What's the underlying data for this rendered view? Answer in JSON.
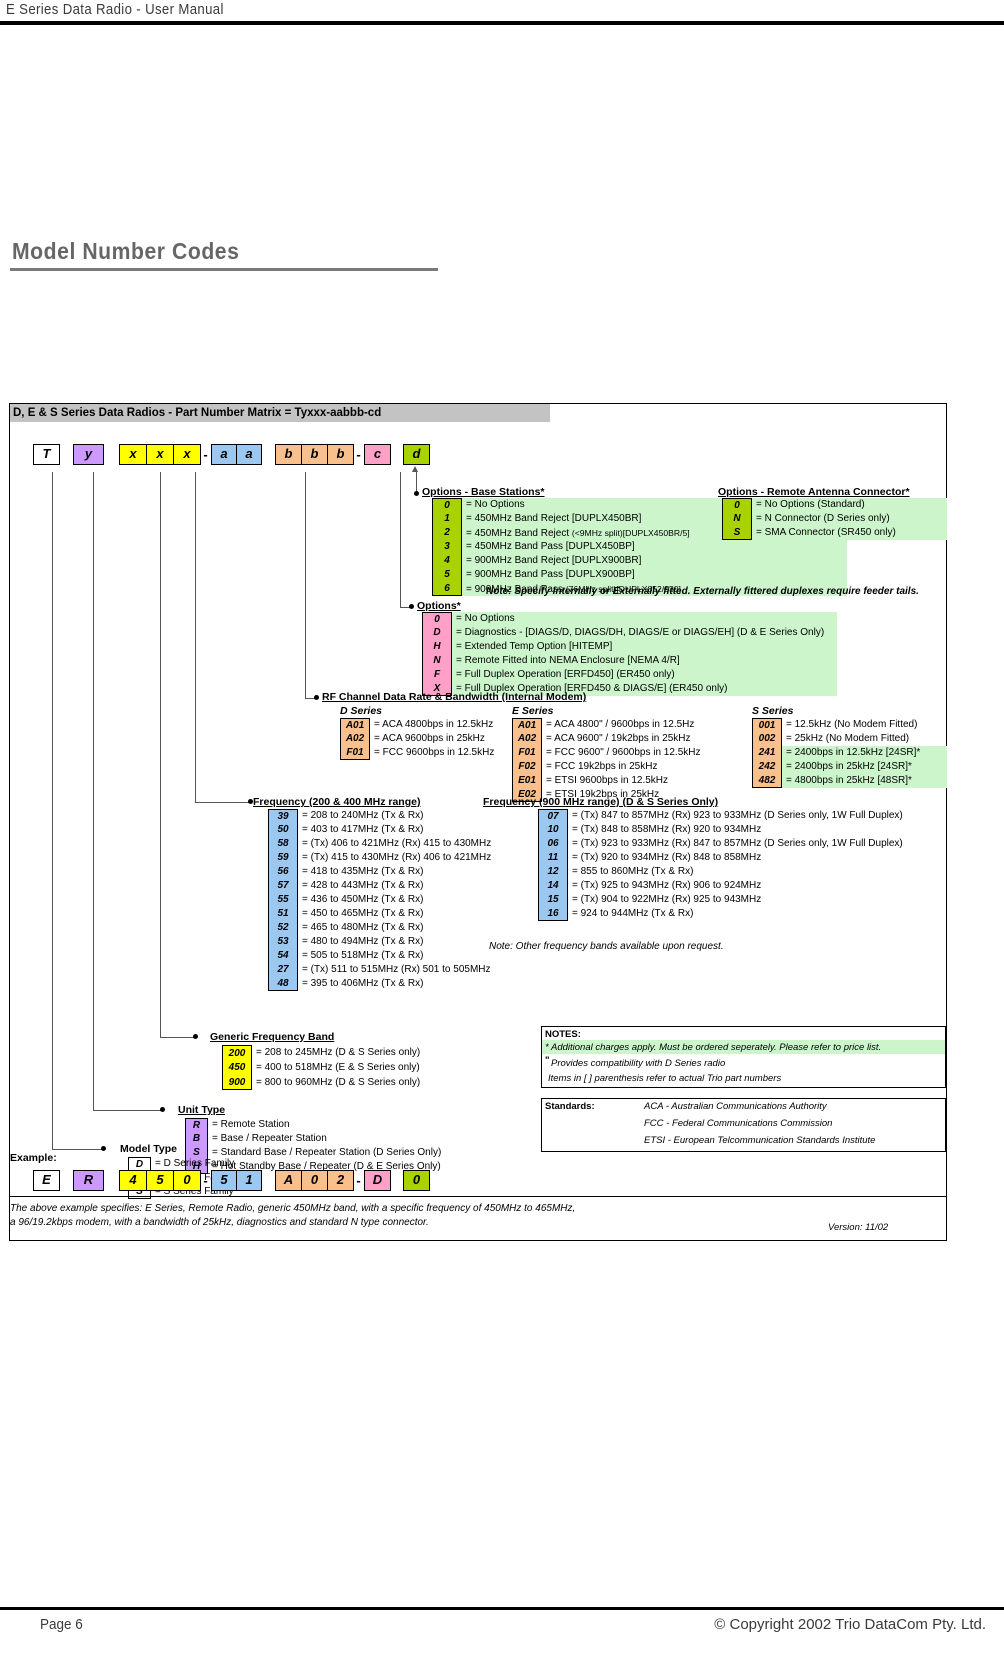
{
  "page": {
    "header_title": "E Series Data Radio - User Manual",
    "section_title": "Model Number Codes",
    "footer_page": "Page 6",
    "footer_copyright": "© Copyright 2002 Trio DataCom Pty. Ltd.",
    "version": "Version: 11/02"
  },
  "matrix": {
    "header": "D, E & S Series Data Radios - Part Number Matrix = Tyxxx-aabbb-cd",
    "code_boxes": [
      {
        "label": "T",
        "color": "white"
      },
      {
        "label": "y",
        "color": "purple"
      },
      {
        "label": "x",
        "color": "yellow"
      },
      {
        "label": "x",
        "color": "yellow"
      },
      {
        "label": "x",
        "color": "yellow"
      },
      {
        "label": "a",
        "color": "blue"
      },
      {
        "label": "a",
        "color": "blue"
      },
      {
        "label": "b",
        "color": "orange"
      },
      {
        "label": "b",
        "color": "orange"
      },
      {
        "label": "b",
        "color": "orange"
      },
      {
        "label": "c",
        "color": "pink"
      },
      {
        "label": "d",
        "color": "green"
      }
    ],
    "dash1": "-",
    "dash2": "-"
  },
  "options_base": {
    "title": "Options - Base Stations*",
    "rows": [
      {
        "code": "0",
        "desc": "= No Options",
        "small": ""
      },
      {
        "code": "1",
        "desc": "= 450MHz Band Reject [DUPLX450BR]",
        "small": ""
      },
      {
        "code": "2",
        "desc": "= 450MHz Band Reject ",
        "small": "(<9MHz split)[DUPLX450BR/5]"
      },
      {
        "code": "3",
        "desc": "= 450MHz Band Pass [DUPLX450BP]",
        "small": ""
      },
      {
        "code": "4",
        "desc": "= 900MHz Band Reject [DUPLX900BR]",
        "small": ""
      },
      {
        "code": "5",
        "desc": "= 900MHz Band Pass [DUPLX900BP]",
        "small": ""
      },
      {
        "code": "6",
        "desc": "= 900MHz Band Pass ",
        "small": "(76MHz split)[DUPLX852/930]"
      }
    ],
    "note": "Note: Specify Internally or Externally fitted. Externally fittered duplexes require feeder tails."
  },
  "options_remote": {
    "title": "Options - Remote Antenna Connector*",
    "rows": [
      {
        "code": "0",
        "desc": "= No Options (Standard)"
      },
      {
        "code": "N",
        "desc": "= N Connector (D Series only)"
      },
      {
        "code": "S",
        "desc": "= SMA Connector (SR450 only)"
      }
    ]
  },
  "options_main": {
    "title": "Options*",
    "rows": [
      {
        "code": "0",
        "desc": "= No Options"
      },
      {
        "code": "D",
        "desc": "= Diagnostics - [DIAGS/D, DIAGS/DH, DIAGS/E or DIAGS/EH] (D & E Series Only)"
      },
      {
        "code": "H",
        "desc": "= Extended Temp Option [HITEMP]"
      },
      {
        "code": "N",
        "desc": "= Remote Fitted into NEMA Enclosure [NEMA 4/R]"
      },
      {
        "code": "F",
        "desc": "= Full Duplex Operation [ERFD450] (ER450 only)"
      },
      {
        "code": "X",
        "desc": "= Full Duplex Operation [ERFD450 & DIAGS/E] (ER450 only)"
      }
    ]
  },
  "rf_channel": {
    "title": "RF Channel Data Rate & Bandwidth (Internal Modem)",
    "d_series": {
      "label": "D Series",
      "rows": [
        {
          "code": "A01",
          "desc": "= ACA 4800bps in 12.5kHz"
        },
        {
          "code": "A02",
          "desc": "= ACA 9600bps in 25kHz"
        },
        {
          "code": "F01",
          "desc": "= FCC 9600bps in 12.5kHz"
        }
      ]
    },
    "e_series": {
      "label": "E Series",
      "rows": [
        {
          "code": "A01",
          "desc": "= ACA 4800\" / 9600bps in 12.5Hz"
        },
        {
          "code": "A02",
          "desc": "= ACA  9600\" / 19k2bps in 25kHz"
        },
        {
          "code": "F01",
          "desc": "= FCC 9600\" / 9600bps in 12.5kHz"
        },
        {
          "code": "F02",
          "desc": "= FCC 19k2bps in 25kHz"
        },
        {
          "code": "E01",
          "desc": "= ETSI 9600bps in 12.5kHz"
        },
        {
          "code": "E02",
          "desc": "= ETSI 19k2bps in 25kHz"
        }
      ]
    },
    "s_series": {
      "label": "S Series",
      "rows": [
        {
          "code": "001",
          "desc": "= 12.5kHz (No Modem Fitted)",
          "hl": false
        },
        {
          "code": "002",
          "desc": "= 25kHz (No Modem Fitted)",
          "hl": false
        },
        {
          "code": "241",
          "desc": "= 2400bps in 12.5kHz [24SR]*",
          "hl": true
        },
        {
          "code": "242",
          "desc": "= 2400bps in 25kHz [24SR]*",
          "hl": true
        },
        {
          "code": "482",
          "desc": "= 4800bps in 25kHz [48SR]*",
          "hl": true
        }
      ]
    }
  },
  "freq_200_400": {
    "title": "Frequency (200 & 400 MHz range)",
    "rows": [
      {
        "code": "39",
        "desc": "= 208 to 240MHz (Tx & Rx)"
      },
      {
        "code": "50",
        "desc": "= 403 to 417MHz (Tx & Rx)"
      },
      {
        "code": "58",
        "desc": "= (Tx) 406 to 421MHz (Rx) 415 to 430MHz"
      },
      {
        "code": "59",
        "desc": "= (Tx) 415 to 430MHz (Rx) 406 to 421MHz"
      },
      {
        "code": "56",
        "desc": "= 418 to 435MHz (Tx & Rx)"
      },
      {
        "code": "57",
        "desc": "= 428 to 443MHz (Tx & Rx)"
      },
      {
        "code": "55",
        "desc": "= 436 to 450MHz (Tx & Rx)"
      },
      {
        "code": "51",
        "desc": "= 450 to 465MHz (Tx & Rx)"
      },
      {
        "code": "52",
        "desc": "= 465 to 480MHz (Tx & Rx)"
      },
      {
        "code": "53",
        "desc": "= 480 to 494MHz (Tx & Rx)"
      },
      {
        "code": "54",
        "desc": "= 505 to 518MHz (Tx & Rx)"
      },
      {
        "code": "27",
        "desc": "= (Tx) 511 to 515MHz (Rx) 501 to 505MHz"
      },
      {
        "code": "48",
        "desc": "= 395 to 406MHz (Tx & Rx)"
      }
    ]
  },
  "freq_900": {
    "title": "Frequency (900 MHz range) (D & S Series Only)",
    "rows": [
      {
        "code": "07",
        "desc": "= (Tx) 847 to 857MHz (Rx) 923 to 933MHz (D Series only, 1W Full Duplex)"
      },
      {
        "code": "10",
        "desc": "= (Tx) 848 to 858MHz (Rx) 920 to 934MHz"
      },
      {
        "code": "06",
        "desc": "= (Tx) 923 to 933MHz (Rx) 847 to 857MHz (D Series only, 1W Full Duplex)"
      },
      {
        "code": "11",
        "desc": "= (Tx) 920 to 934MHz (Rx) 848 to 858MHz"
      },
      {
        "code": "12",
        "desc": "= 855 to 860MHz (Tx & Rx)"
      },
      {
        "code": "14",
        "desc": "= (Tx) 925 to 943MHz (Rx) 906 to 924MHz"
      },
      {
        "code": "15",
        "desc": "= (Tx) 904 to 922MHz (Rx) 925 to 943MHz"
      },
      {
        "code": "16",
        "desc": "= 924 to 944MHz (Tx & Rx)"
      }
    ],
    "note": "Note: Other frequency bands available upon request."
  },
  "generic_band": {
    "title": "Generic Frequency Band",
    "rows": [
      {
        "code": "200",
        "desc": "= 208 to 245MHz (D & S Series only)"
      },
      {
        "code": "450",
        "desc": "= 400 to 518MHz (E & S Series only)"
      },
      {
        "code": "900",
        "desc": "= 800 to 960MHz (D & S Series only)"
      }
    ]
  },
  "unit_type": {
    "title": "Unit Type",
    "rows": [
      {
        "code": "R",
        "desc": "= Remote Station"
      },
      {
        "code": "B",
        "desc": "= Base / Repeater Station"
      },
      {
        "code": "S",
        "desc": "= Standard Base / Repeater Station (D Series Only)"
      },
      {
        "code": "H",
        "desc": "= Hot Standby Base / Repeater (D & E Series Only)"
      }
    ]
  },
  "model_type": {
    "title": "Model Type",
    "rows": [
      {
        "code": "D",
        "desc": "= D Series Family"
      },
      {
        "code": "E",
        "desc": "= E Series Family"
      },
      {
        "code": "S",
        "desc": "= S Series Family"
      }
    ]
  },
  "notes_box": {
    "title": "NOTES:",
    "line1": "* Additional charges apply. Must be ordered seperately. Please refer to price list.",
    "line2_marker": "\"",
    "line2": " Provides compatibility with D Series radio",
    "line3": "Items in  [ ]  parenthesis refer to actual Trio part numbers"
  },
  "standards_box": {
    "label": "Standards:",
    "lines": [
      "ACA - Australian Communications Authority",
      "FCC - Federal Communications Commission",
      "ETSI - European Telcommunication Standards Institute"
    ]
  },
  "example": {
    "label": "Example:",
    "code_boxes": [
      {
        "label": "E",
        "color": "white"
      },
      {
        "label": "R",
        "color": "purple"
      },
      {
        "label": "4",
        "color": "yellow"
      },
      {
        "label": "5",
        "color": "yellow"
      },
      {
        "label": "0",
        "color": "yellow"
      },
      {
        "label": "5",
        "color": "blue"
      },
      {
        "label": "1",
        "color": "blue"
      },
      {
        "label": "A",
        "color": "orange"
      },
      {
        "label": "0",
        "color": "orange"
      },
      {
        "label": "2",
        "color": "orange"
      },
      {
        "label": "D",
        "color": "pink"
      },
      {
        "label": "0",
        "color": "green"
      }
    ],
    "line1": "The above example specifies: E Series, Remote Radio, generic 450MHz band, with a specific frequency of 450MHz to 465MHz,",
    "line2": "a 96/19.2kbps modem, with a bandwidth of 25kHz, diagnostics and standard N type connector."
  }
}
